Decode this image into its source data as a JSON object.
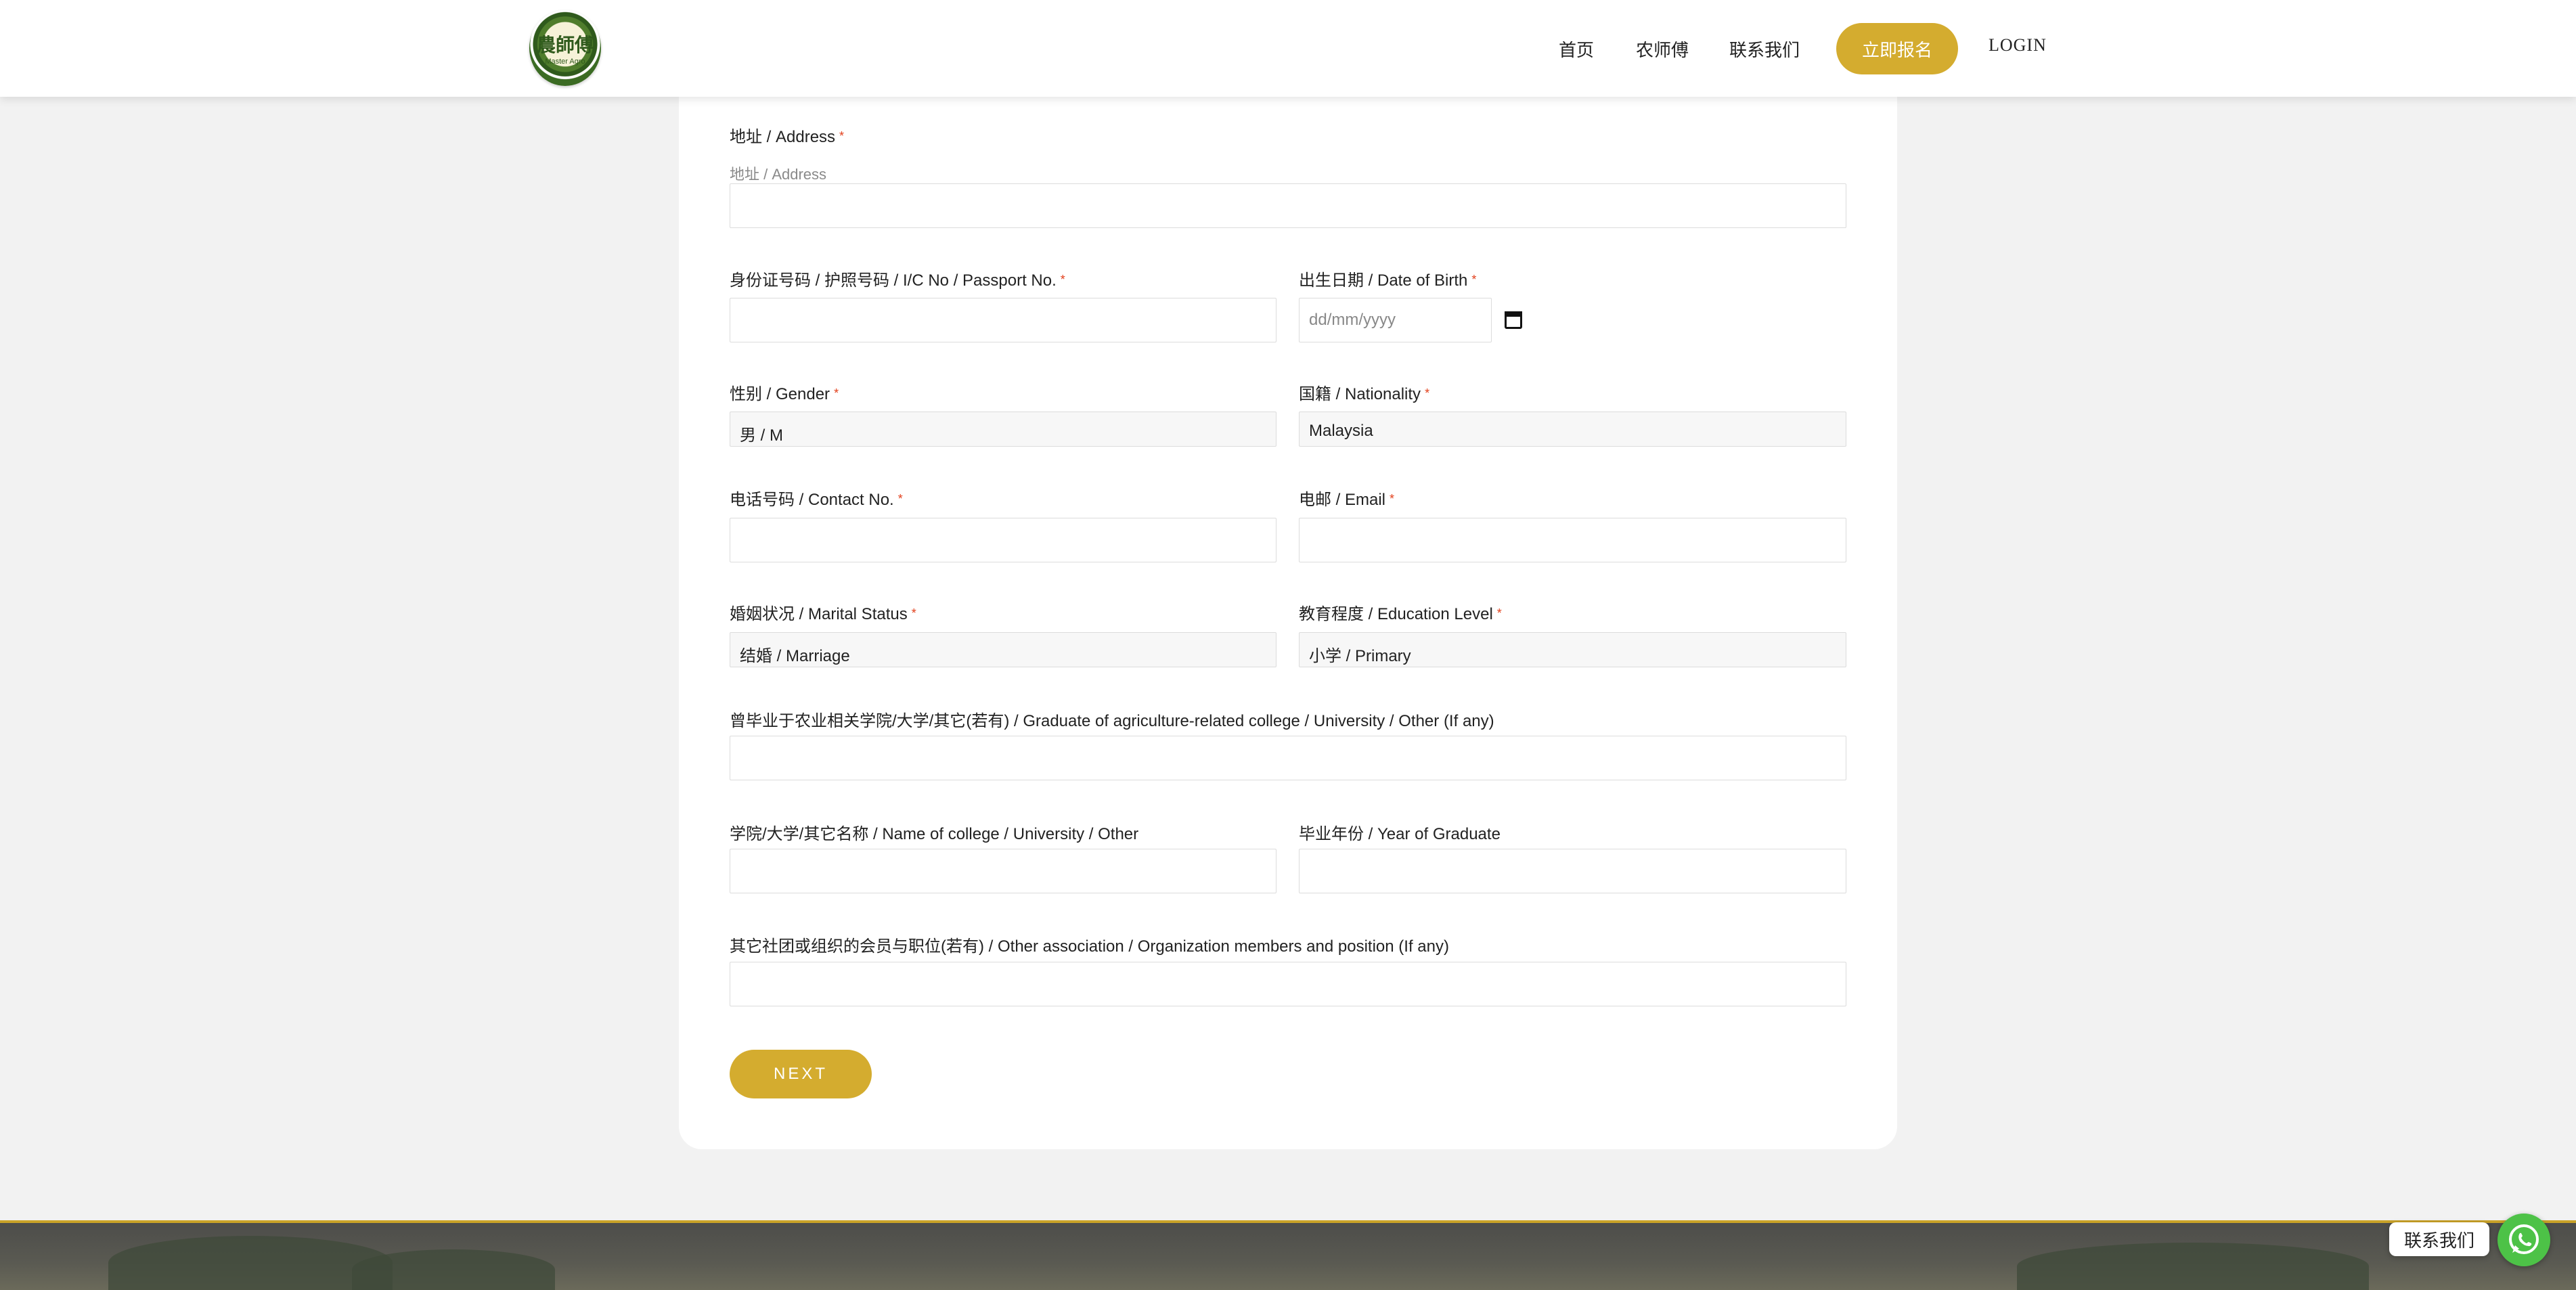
{
  "header": {
    "logo": {
      "text": "農師傅",
      "sub": "Master Agro"
    },
    "nav": {
      "home": "首页",
      "master": "农师傅",
      "contact": "联系我们",
      "register": "立即报名",
      "login": "LOGIN"
    }
  },
  "form": {
    "address": {
      "label": "地址 / Address",
      "placeholder": "地址 / Address",
      "required": "*"
    },
    "ic": {
      "label": "身份证号码 / 护照号码 / I/C No / Passport No.",
      "required": "*"
    },
    "dob": {
      "label": "出生日期 / Date of Birth",
      "placeholder": "dd/mm/yyyy",
      "required": "*"
    },
    "gender": {
      "label": "性别 / Gender",
      "value": "男 / M",
      "required": "*"
    },
    "nationality": {
      "label": "国籍 / Nationality",
      "value": "Malaysia",
      "required": "*"
    },
    "contact": {
      "label": "电话号码 / Contact No.",
      "required": "*"
    },
    "email": {
      "label": "电邮 / Email",
      "required": "*"
    },
    "marital": {
      "label": "婚姻状况 / Marital Status",
      "value": "结婚 / Marriage",
      "required": "*"
    },
    "education": {
      "label": "教育程度 / Education Level",
      "value": "小学 / Primary",
      "required": "*"
    },
    "graduate": {
      "label": "曾毕业于农业相关学院/大学/其它(若有) / Graduate of agriculture-related college / University / Other (If any)"
    },
    "college_name": {
      "label": "学院/大学/其它名称 / Name of college / University / Other"
    },
    "grad_year": {
      "label": "毕业年份 / Year of Graduate"
    },
    "association": {
      "label": "其它社团或组织的会员与职位(若有) / Other association / Organization members and position (If any)"
    },
    "next": "NEXT"
  },
  "chat": {
    "label": "联系我们"
  },
  "colors": {
    "accent": "#d4ac2f",
    "required": "#e2401c",
    "whatsapp": "#4dc247"
  },
  "icons": {
    "calendar": "calendar-icon",
    "whatsapp": "whatsapp-icon"
  }
}
